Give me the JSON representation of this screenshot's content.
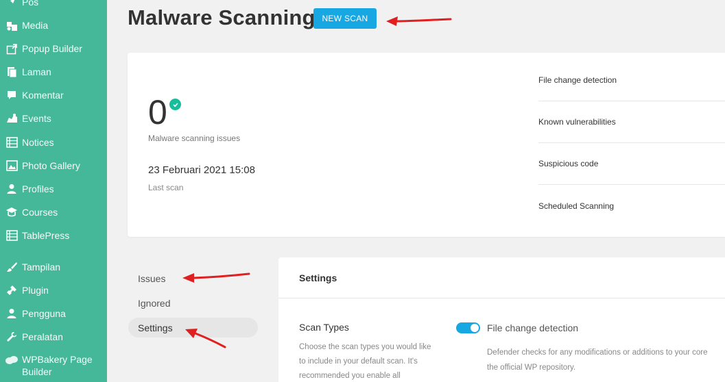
{
  "sidebar": {
    "items": [
      {
        "label": "Pos",
        "icon": "pin-icon"
      },
      {
        "label": "Media",
        "icon": "media-icon"
      },
      {
        "label": "Popup Builder",
        "icon": "popup-icon"
      },
      {
        "label": "Laman",
        "icon": "pages-icon"
      },
      {
        "label": "Komentar",
        "icon": "comment-icon"
      },
      {
        "label": "Events",
        "icon": "events-icon"
      },
      {
        "label": "Notices",
        "icon": "list-icon"
      },
      {
        "label": "Photo Gallery",
        "icon": "gallery-icon"
      },
      {
        "label": "Profiles",
        "icon": "user-icon"
      },
      {
        "label": "Courses",
        "icon": "courses-icon"
      },
      {
        "label": "TablePress",
        "icon": "table-icon"
      },
      {
        "label": "Tampilan",
        "icon": "brush-icon"
      },
      {
        "label": "Plugin",
        "icon": "plugin-icon"
      },
      {
        "label": "Pengguna",
        "icon": "user-icon"
      },
      {
        "label": "Peralatan",
        "icon": "wrench-icon"
      },
      {
        "label": "WPBakery Page Builder",
        "icon": "wpbakery-icon"
      }
    ]
  },
  "header": {
    "title": "Malware Scanning",
    "new_scan_label": "NEW SCAN"
  },
  "summary": {
    "issues_count": "0",
    "issues_label": "Malware scanning issues",
    "last_scan_date": "23 Februari 2021 15:08",
    "last_scan_label": "Last scan",
    "status_items": [
      "File change detection",
      "Known vulnerabilities",
      "Suspicious code",
      "Scheduled Scanning"
    ]
  },
  "tabs": {
    "issues": "Issues",
    "ignored": "Ignored",
    "settings": "Settings"
  },
  "settings_panel": {
    "title": "Settings",
    "scan_types_title": "Scan Types",
    "scan_types_desc": "Choose the scan types you would like to include in your default scan. It's recommended you enable all",
    "file_change": {
      "title": "File change detection",
      "enabled": true,
      "desc": "Defender checks for any modifications or additions to your core",
      "desc2": "the official WP repository."
    }
  },
  "colors": {
    "sidebar": "#46b89a",
    "accent": "#17a8e3",
    "success": "#1abc9c",
    "annotation": "#e02020"
  }
}
